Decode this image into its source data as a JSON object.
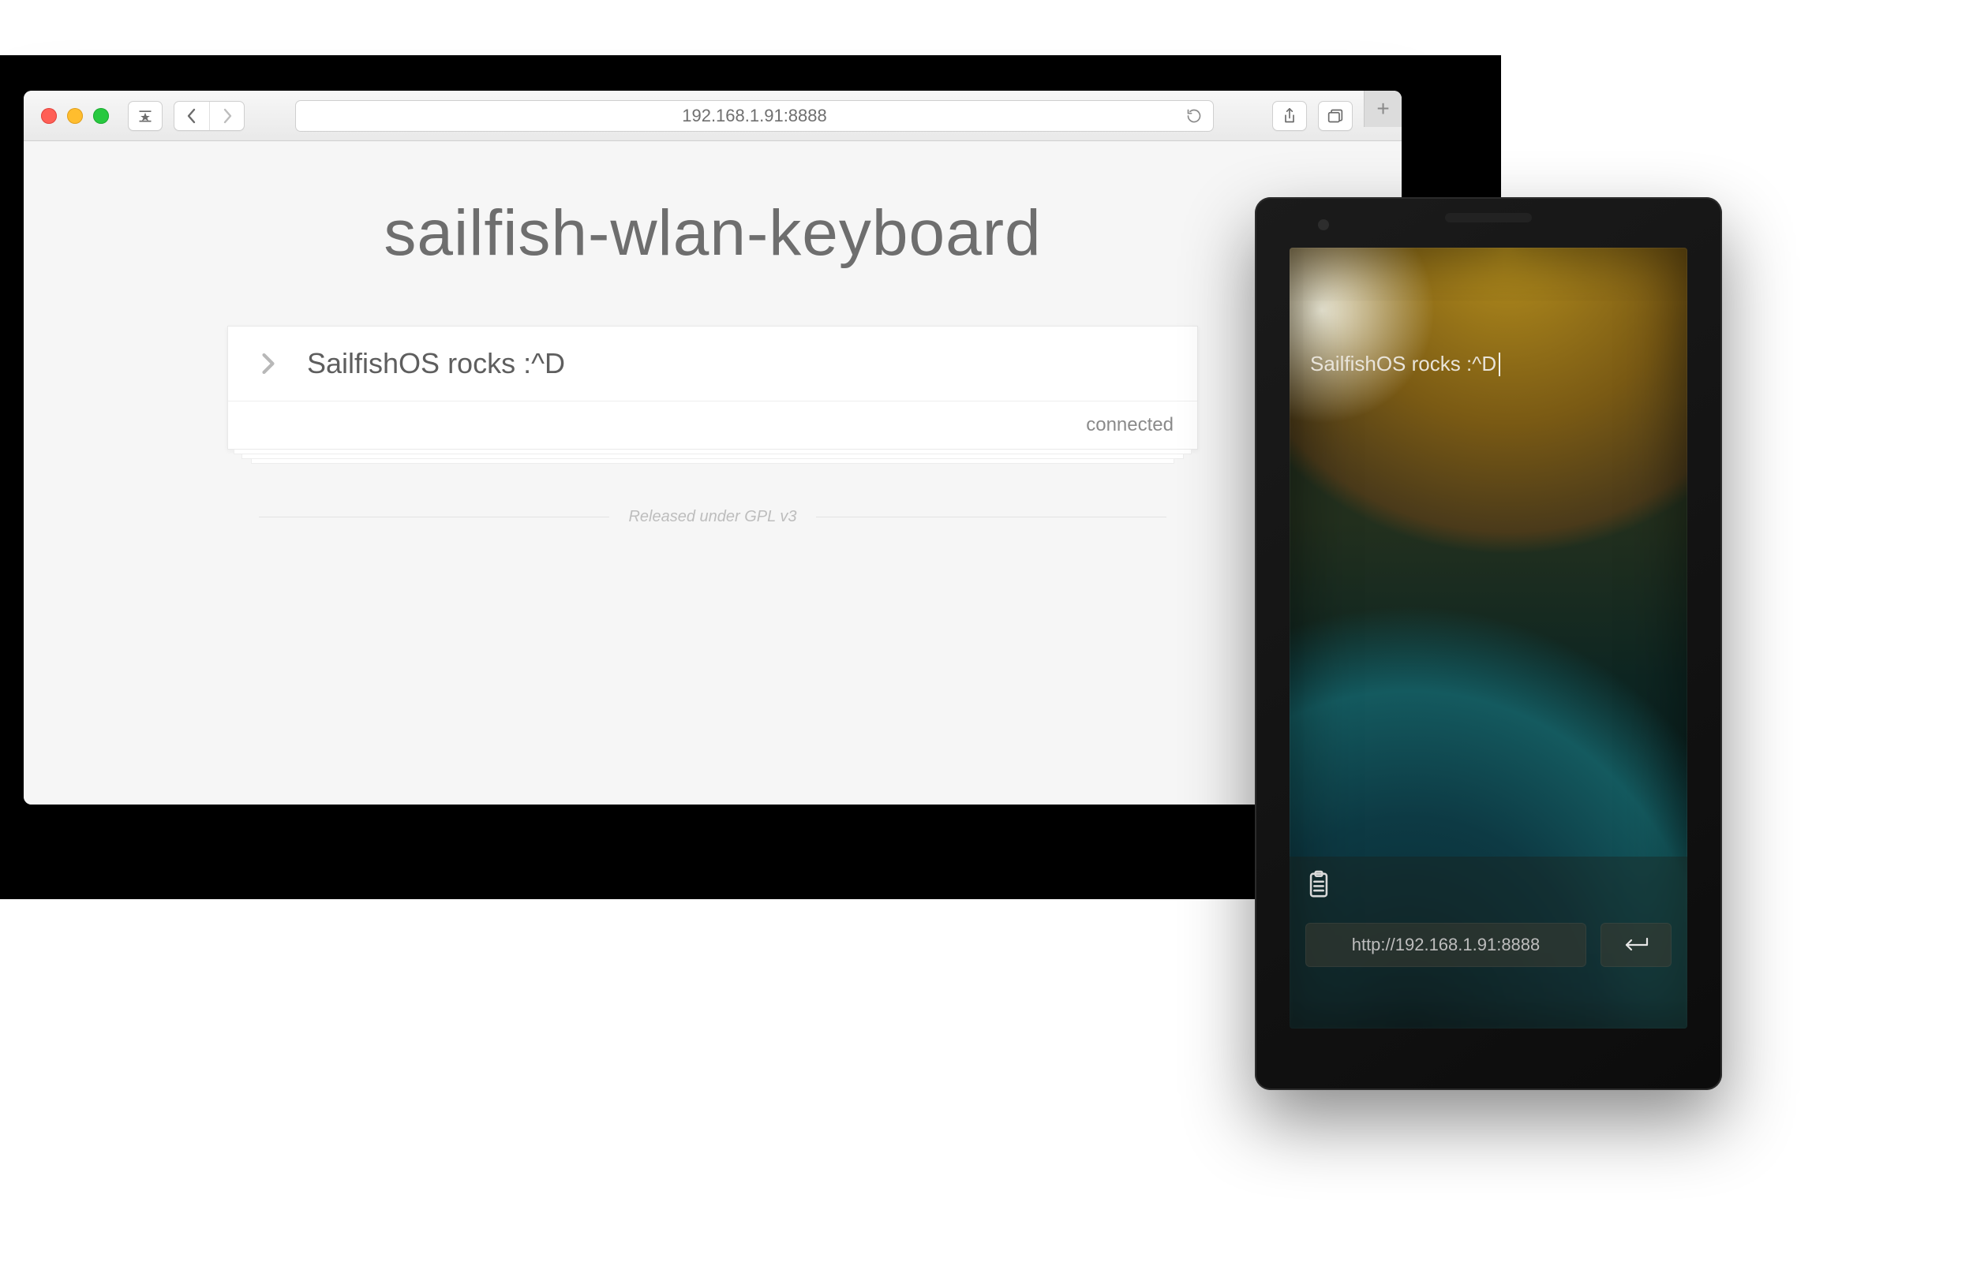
{
  "browser": {
    "address": "192.168.1.91:8888",
    "icons": {
      "bookmarks": "bookmarks-icon",
      "back": "chevron-left-icon",
      "forward": "chevron-right-icon",
      "reload": "reload-icon",
      "share": "share-icon",
      "tabs": "tabs-icon",
      "newtab": "plus-icon"
    }
  },
  "page": {
    "title": "sailfish-wlan-keyboard",
    "input_value": "SailfishOS rocks :^D",
    "status": "connected",
    "license": "Released under GPL v3"
  },
  "phone": {
    "display_text": "SailfishOS rocks :^D",
    "address": "http://192.168.1.91:8888",
    "icons": {
      "clipboard": "clipboard-icon",
      "enter": "return-icon"
    }
  }
}
